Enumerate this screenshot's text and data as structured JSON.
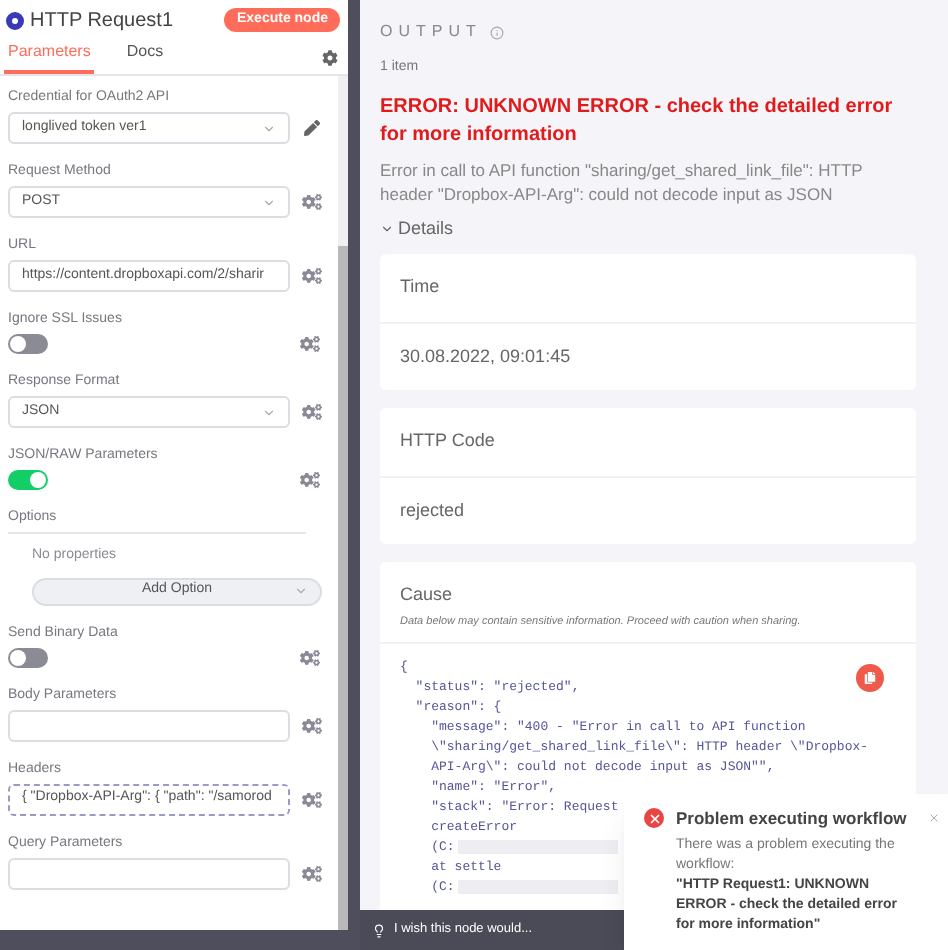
{
  "node": {
    "title": "HTTP Request1",
    "execute_button": "Execute node"
  },
  "tabs": [
    {
      "label": "Parameters",
      "selected": true
    },
    {
      "label": "Docs",
      "selected": false
    }
  ],
  "parameters": [
    {
      "kind": "credential",
      "label": "Credential for OAuth2 API",
      "value": "longlived token ver1"
    },
    {
      "kind": "select",
      "label": "Request Method",
      "value": "POST"
    },
    {
      "kind": "text",
      "label": "URL",
      "value": "https://content.dropboxapi.com/2/sharir"
    },
    {
      "kind": "toggle",
      "label": "Ignore SSL Issues",
      "on": false
    },
    {
      "kind": "select",
      "label": "Response Format",
      "value": "JSON"
    },
    {
      "kind": "toggle",
      "label": "JSON/RAW Parameters",
      "on": true
    },
    {
      "kind": "options",
      "label": "Options",
      "empty_text": "No properties",
      "button": "Add Option"
    },
    {
      "kind": "toggle",
      "label": "Send Binary Data",
      "on": false
    },
    {
      "kind": "text",
      "label": "Body Parameters"
    },
    {
      "kind": "expression",
      "label": "Headers",
      "value": "{ \"Dropbox-API-Arg\": { \"path\": \"/samorod"
    },
    {
      "kind": "text",
      "label": "Query Parameters"
    }
  ],
  "output": {
    "title": "OUTPUT",
    "count": "1 item",
    "error_title": "ERROR: UNKNOWN ERROR - check the detailed error for more information",
    "error_message": "Error in call to API function \"sharing/get_shared_link_file\": HTTP header \"Dropbox-API-Arg\": could not decode input as JSON",
    "details_toggle": "Details",
    "details_expanded": true,
    "details": [
      {
        "label": "Time",
        "value": "30.08.2022, 09:01:45"
      },
      {
        "label": "HTTP Code",
        "value": "rejected"
      }
    ],
    "cause": {
      "label": "Cause",
      "note": "Data below may contain sensitive information. Proceed with caution when sharing.",
      "code_lines": [
        {
          "text": "{"
        },
        {
          "text": "  \"status\": \"rejected\","
        },
        {
          "text": "  \"reason\": {"
        },
        {
          "text": "    \"message\": \"400 - \"Error in call to API function"
        },
        {
          "text": "    \\\"sharing/get_shared_link_file\\\": HTTP header \\\"Dropbox-"
        },
        {
          "text": "    API-Arg\\\": could not decode input as JSON\"\","
        },
        {
          "text": "    \"name\": \"Error\","
        },
        {
          "text": "    \"stack\": \"Error: Request"
        },
        {
          "text": "    createError"
        },
        {
          "text": "    (C:",
          "redacted": true
        },
        {
          "text": "    at settle"
        },
        {
          "text": "    (C:",
          "redacted": true
        }
      ]
    }
  },
  "feedback": {
    "text": "I wish this node would..."
  },
  "toast": {
    "title": "Problem executing workflow",
    "message": "There was a problem executing the workflow:",
    "detail": "\"HTTP Request1: UNKNOWN ERROR - check the detailed error for more information\""
  }
}
